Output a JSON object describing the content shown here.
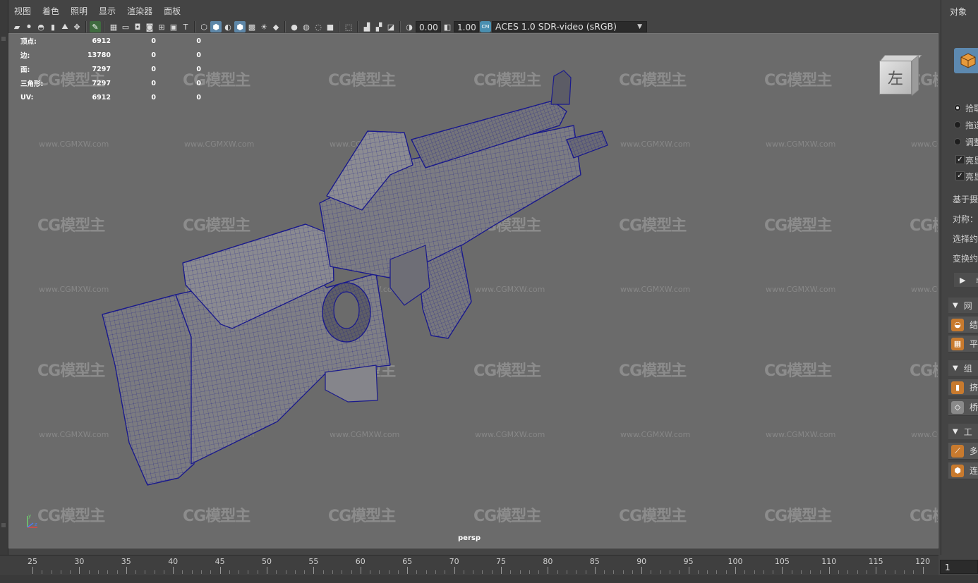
{
  "menu": {
    "items": [
      "视图",
      "着色",
      "照明",
      "显示",
      "渲染器",
      "面板"
    ]
  },
  "toolbar": {
    "icons": [
      "camera-icon",
      "camera-attr-icon",
      "bookmark-icon",
      "image-plane-icon",
      "grid-move-icon",
      "pen-icon",
      "grid-icon",
      "film-gate-icon",
      "resolution-gate-icon",
      "safe-action-icon",
      "field-chart-icon",
      "safe-title-icon",
      "wireframe-cube-icon",
      "shaded-cube-icon",
      "wireframe-on-shaded-icon",
      "default-material-icon",
      "textured-icon",
      "lights-icon",
      "shadows-icon",
      "ambient-occlusion-icon",
      "motion-blur-icon",
      "anti-alias-icon",
      "depth-of-field-icon",
      "isolate-select-icon",
      "xray-icon",
      "xray-joints-icon",
      "xray-components-icon",
      "backface-icon",
      "exposure-icon",
      "gamma-icon"
    ],
    "exposure_value": "0.00",
    "gamma_value": "1.00",
    "colorspace": "ACES 1.0 SDR-video (sRGB)"
  },
  "hud": {
    "rows": [
      {
        "label": "顶点:",
        "v1": "6912",
        "v2": "0",
        "v3": "0"
      },
      {
        "label": "边:",
        "v1": "13780",
        "v2": "0",
        "v3": "0"
      },
      {
        "label": "面:",
        "v1": "7297",
        "v2": "0",
        "v3": "0"
      },
      {
        "label": "三角形:",
        "v1": "7297",
        "v2": "0",
        "v3": "0"
      },
      {
        "label": "UV:",
        "v1": "6912",
        "v2": "0",
        "v3": "0"
      }
    ]
  },
  "viewport": {
    "camera_label": "persp",
    "viewcube_face": "左",
    "axis_labels": {
      "y": "y",
      "z": "z"
    },
    "watermark_logo": "CG模型主",
    "watermark_url": "www.CGMXW.com",
    "background": "#6b6b6b",
    "wire_color": "#1a1a8c",
    "mesh_color": "#7a7a80"
  },
  "timeline": {
    "ticks": [
      "25",
      "30",
      "35",
      "40",
      "45",
      "50",
      "55",
      "60",
      "65",
      "70",
      "75",
      "80",
      "85",
      "90",
      "95",
      "100",
      "105",
      "110",
      "115",
      "120"
    ],
    "current_frame": "1"
  },
  "right_panel": {
    "title": "对象",
    "radios": [
      "拾取",
      "拖选",
      "调整"
    ],
    "checks": [
      "亮显",
      "亮显"
    ],
    "texts": [
      "基于摄",
      "对称：",
      "选择约",
      "变换约"
    ],
    "play_label": "▶",
    "play_text": "卓",
    "sections": [
      {
        "label": "网"
      },
      {
        "label": "组"
      },
      {
        "label": "工"
      }
    ],
    "tools": [
      {
        "label": "结",
        "icon": "combine-icon",
        "color": "#c87a2e"
      },
      {
        "label": "平",
        "icon": "smooth-icon",
        "color": "#c87a2e"
      },
      {
        "label": "挤",
        "icon": "extrude-icon",
        "color": "#c87a2e"
      },
      {
        "label": "桥",
        "icon": "bridge-icon",
        "color": "#8a8a8a"
      },
      {
        "label": "多",
        "icon": "multicut-icon",
        "color": "#c87a2e"
      },
      {
        "label": "连",
        "icon": "connect-icon",
        "color": "#c87a2e"
      }
    ]
  }
}
